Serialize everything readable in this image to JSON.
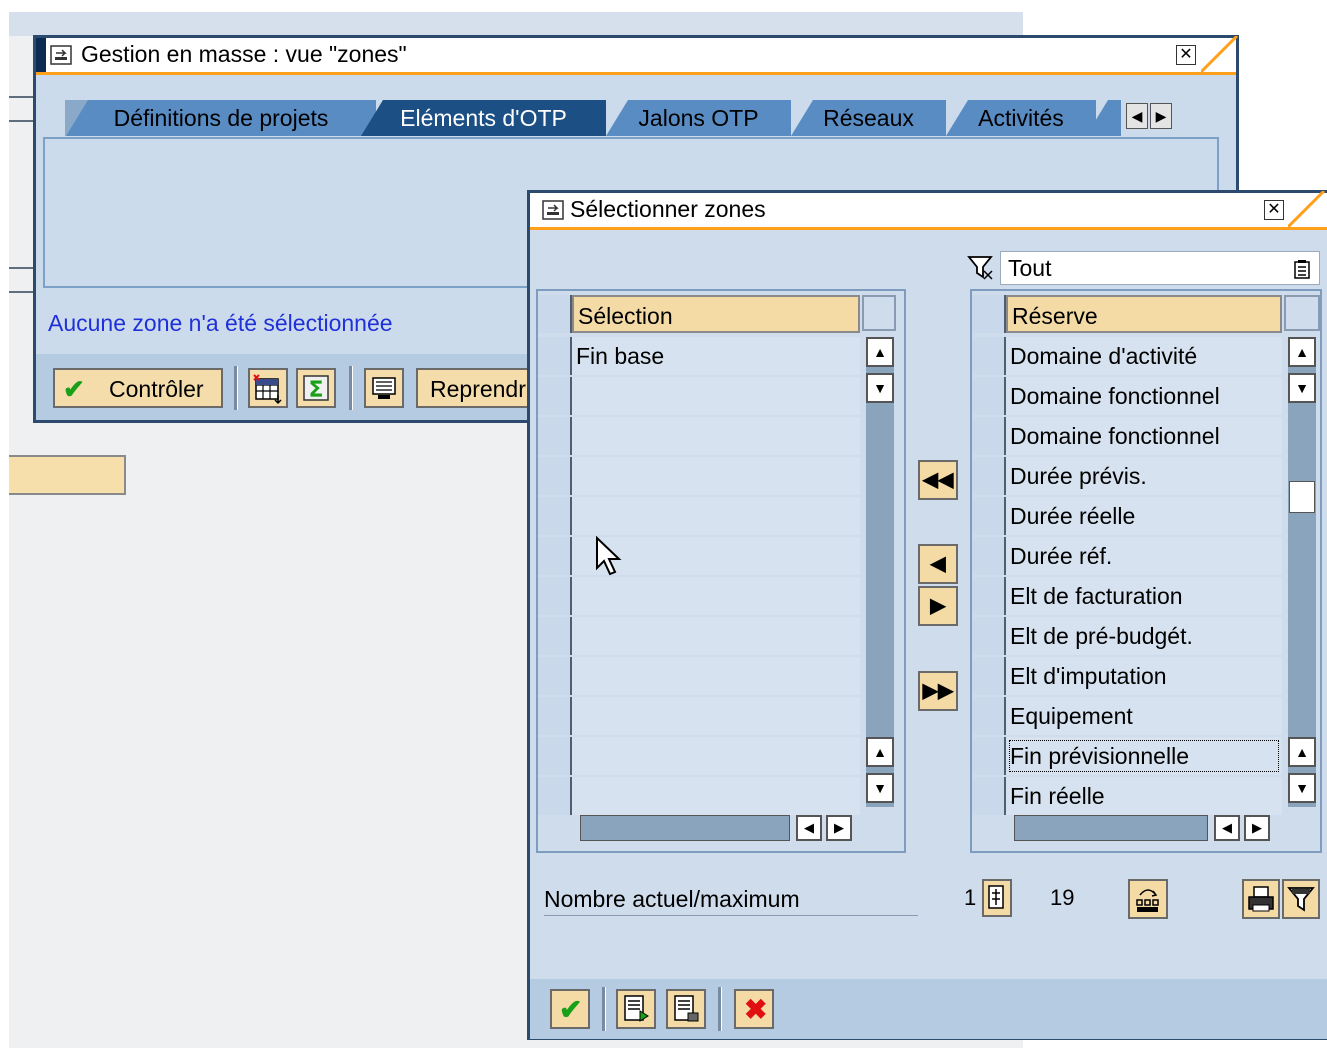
{
  "main_window": {
    "title": "Gestion en masse : vue \"zones\"",
    "tabs": [
      {
        "label": "Définitions de projets",
        "active": false
      },
      {
        "label": "Eléments d'OTP",
        "active": true
      },
      {
        "label": "Jalons OTP",
        "active": false
      },
      {
        "label": "Réseaux",
        "active": false
      },
      {
        "label": "Activités",
        "active": false
      }
    ],
    "message": "Aucune zone n'a été sélectionnée",
    "toolbar": {
      "check_label": "Contrôler",
      "take_over_label": "Reprendr"
    }
  },
  "dialog": {
    "title": "Sélectionner zones",
    "filter_value": "Tout",
    "selected_table": {
      "header": "Sélection",
      "rows": [
        "Fin base",
        "",
        "",
        "",
        "",
        "",
        "",
        "",
        "",
        "",
        "",
        ""
      ]
    },
    "available_table": {
      "header": "Réserve",
      "rows": [
        "Domaine d'activité",
        "Domaine fonctionnel",
        "Domaine fonctionnel",
        "Durée prévis.",
        "Durée réelle",
        "Durée réf.",
        "Elt de facturation",
        "Elt de pré-budgét.",
        "Elt d'imputation",
        "Equipement",
        "Fin prévisionnelle",
        "Fin réelle"
      ]
    },
    "count_label": "Nombre actuel/maximum",
    "current_count": "1",
    "max_count": "19"
  },
  "colors": {
    "title_accent": "#ff9f1a",
    "active_tab": "#1c4f84",
    "message_text": "#2030d8",
    "button_face": "#f4dba6",
    "check_green": "#18a018",
    "cancel_red": "#e01010"
  }
}
